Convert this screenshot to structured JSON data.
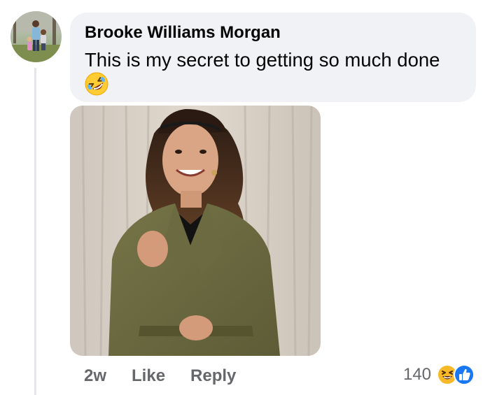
{
  "comment": {
    "author": "Brooke Williams Morgan",
    "text": "This is my secret to getting so much done",
    "emoji_icon": "rolling-on-floor-laughing-emoji",
    "image_icon": "woman-in-olive-coat-photo",
    "timestamp": "2w",
    "like_label": "Like",
    "reply_label": "Reply",
    "reaction_count": "140",
    "reaction_icons": [
      "haha-reaction-icon",
      "like-reaction-icon"
    ]
  },
  "colors": {
    "bubble_bg": "#f0f2f5",
    "secondary_text": "#65676b",
    "like_blue": "#1877f2",
    "haha_yellow": "#f7b928"
  }
}
